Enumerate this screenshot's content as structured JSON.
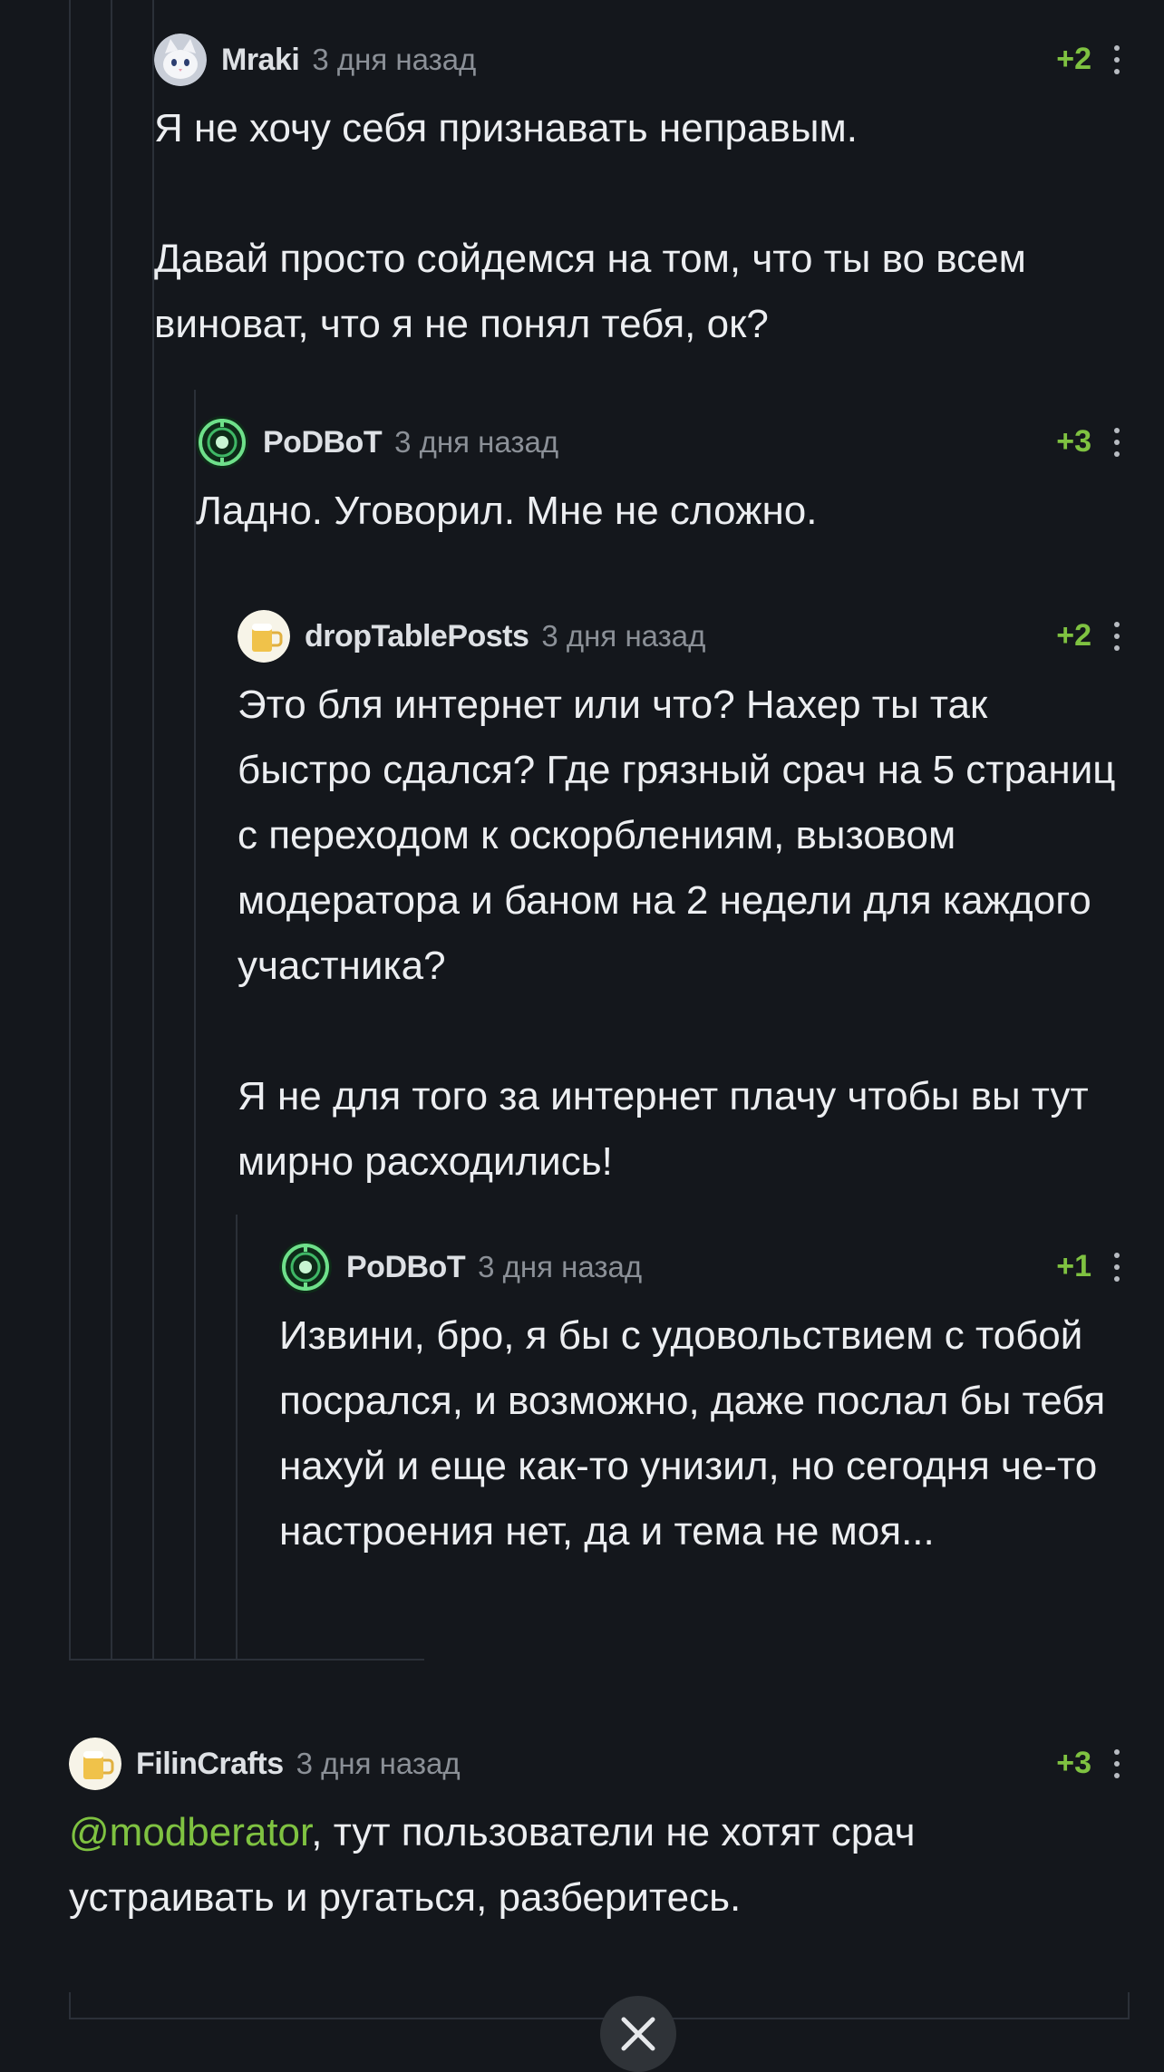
{
  "comments": [
    {
      "author": "Mraki",
      "time": "3 дня назад",
      "rating": "+2",
      "avatar": "cat-avatar",
      "paragraphs": [
        "Я не хочу себя признавать неправым.",
        "Давай просто сойдемся на том, что ты во всем виноват, что я не понял тебя, ок?"
      ]
    },
    {
      "author": "PoDBoT",
      "time": "3 дня назад",
      "rating": "+3",
      "avatar": "robot-avatar",
      "paragraphs": [
        "Ладно. Уговорил. Мне не сложно."
      ]
    },
    {
      "author": "dropTablePosts",
      "time": "3 дня назад",
      "rating": "+2",
      "avatar": "beer-avatar",
      "paragraphs": [
        "Это бля интернет или что? Нахер ты так быстро сдался? Где грязный срач на 5 страниц с переходом к оскорблениям, вызовом модератора и баном на 2 недели для каждого участника?",
        "Я не для того за интернет плачу чтобы вы тут мирно расходились!"
      ]
    },
    {
      "author": "PoDBoT",
      "time": "3 дня назад",
      "rating": "+1",
      "avatar": "robot-avatar",
      "paragraphs": [
        "Извини, бро, я бы с удовольствием с тобой посрался, и возможно, даже послал бы тебя нахуй и еще как-то унизил, но сегодня че-то настроения нет, да и тема не моя..."
      ]
    },
    {
      "author": "FilinCrafts",
      "time": "3 дня назад",
      "rating": "+3",
      "avatar": "beer-avatar",
      "mention": "@modberator",
      "paragraphs": [
        ", тут пользователи не хотят срач устраивать и ругаться, разберитесь."
      ]
    }
  ],
  "icons": {
    "more": "more-vertical-icon",
    "close": "close-icon"
  },
  "colors": {
    "background": "#14171c",
    "rating": "#7fc241",
    "mention": "#7fc241",
    "thread_line": "#2b3038"
  }
}
